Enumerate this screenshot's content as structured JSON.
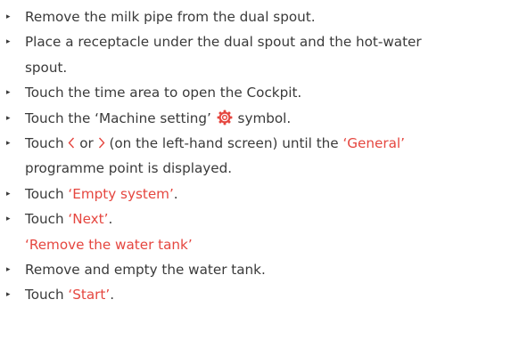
{
  "steps": [
    {
      "text": "Remove the milk pipe from the dual spout."
    },
    {
      "line1": "Place a receptacle under the dual spout and the hot-water",
      "line2": "spout."
    },
    {
      "text": "Touch the time area to open the Cockpit."
    },
    {
      "pre": "Touch the ‘Machine setting’ ",
      "icon": "gear-icon",
      "post": " symbol."
    },
    {
      "pre": "Touch ",
      "icon_left": "chevron-left-icon",
      "mid": " or ",
      "icon_right": "chevron-right-icon",
      "post": " (on the left-hand screen) until the ",
      "highlight": "‘General’",
      "line2": "programme point is displayed."
    },
    {
      "pre": "Touch ",
      "highlight": "‘Empty system’",
      "post": "."
    },
    {
      "pre": "Touch ",
      "highlight": "‘Next’",
      "post": ".",
      "message": "‘Remove the water tank’"
    },
    {
      "text": "Remove and empty the water tank."
    },
    {
      "pre": "Touch ",
      "highlight": "‘Start’",
      "post": "."
    }
  ],
  "bullet_glyph": "▸",
  "colors": {
    "text": "#3a3a3a",
    "highlight": "#e5463f",
    "icon": "#e5463f"
  }
}
